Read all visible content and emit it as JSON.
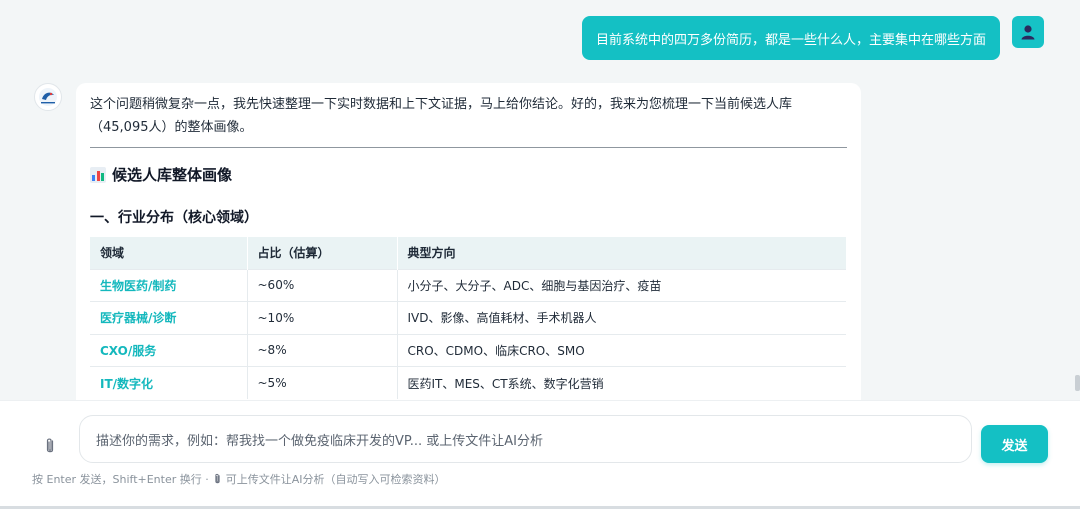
{
  "user_message": {
    "text": "目前系统中的四万多份简历，都是一些什么人，主要集中在哪些方面"
  },
  "bot_message": {
    "intro": "这个问题稍微复杂一点，我先快速整理一下实时数据和上下文证据，马上给你结论。好的，我来为您梳理一下当前候选人库（45,095人）的整体画像。",
    "heading": "候选人库整体画像",
    "heading_icon": "bar-chart-emoji-icon",
    "subheading": "一、行业分布（核心领域）",
    "table": {
      "headers": [
        "领域",
        "占比（估算）",
        "典型方向"
      ],
      "rows": [
        [
          "生物医药/制药",
          "~60%",
          "小分子、大分子、ADC、细胞与基因治疗、疫苗"
        ],
        [
          "医疗器械/诊断",
          "~10%",
          "IVD、影像、高值耗材、手术机器人"
        ],
        [
          "CXO/服务",
          "~8%",
          "CRO、CDMO、临床CRO、SMO"
        ],
        [
          "IT/数字化",
          "~5%",
          "医药IT、MES、CT系统、数字化营销"
        ]
      ]
    }
  },
  "composer": {
    "placeholder": "描述你的需求，例如：帮我找一个做免疫临床开发的VP... 或上传文件让AI分析",
    "send_label": "发送",
    "attach_icon": "paperclip-icon",
    "hint_prefix": "按 Enter 发送，Shift+Enter 换行 ·",
    "hint_suffix": "可上传文件让AI分析（自动写入可检索资料）"
  },
  "colors": {
    "accent": "#14c0c4",
    "domain_text": "#14b8bd",
    "table_header_bg": "#eaf3f4"
  }
}
